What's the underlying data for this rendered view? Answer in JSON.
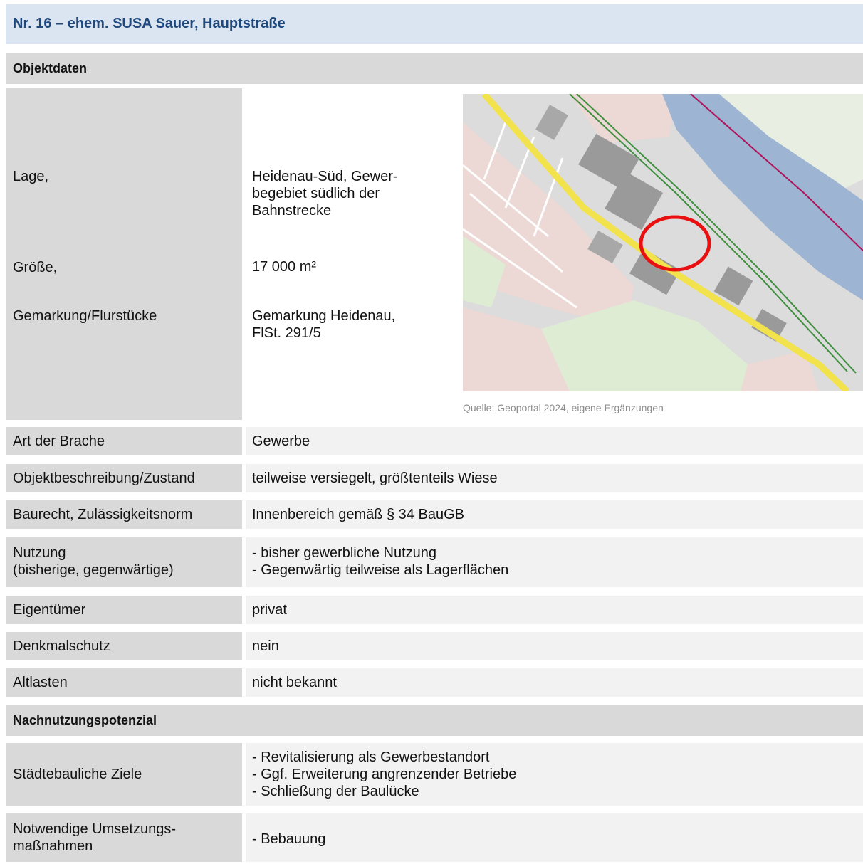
{
  "title": "Nr. 16 – ehem. SUSA Sauer, Hauptstraße",
  "sections": {
    "objektdaten": "Objektdaten",
    "nachnutzung": "Nachnutzungspotenzial"
  },
  "objekt": {
    "lage_label": "Lage,",
    "lage_value": [
      "Heidenau-Süd, Gewer-",
      "begebiet südlich der",
      "Bahnstrecke"
    ],
    "groesse_label": "Größe,",
    "groesse_value": "17 000 m²",
    "gemarkung_label": "Gemarkung/Flurstücke",
    "gemarkung_value": [
      "Gemarkung Heidenau,",
      "FlSt. 291/5"
    ]
  },
  "map": {
    "caption": "Quelle: Geoportal 2024, eigene Ergänzungen"
  },
  "rows": [
    {
      "label": [
        "Art der Brache"
      ],
      "value": [
        "Gewerbe"
      ]
    },
    {
      "label": [
        "Objektbeschreibung/Zustand"
      ],
      "value": [
        "teilweise versiegelt, größtenteils Wiese"
      ]
    },
    {
      "label": [
        "Baurecht, Zulässigkeitsnorm"
      ],
      "value": [
        "Innenbereich gemäß § 34 BauGB"
      ]
    },
    {
      "label": [
        "Nutzung",
        "(bisherige, gegenwärtige)"
      ],
      "value": [
        "-  bisher gewerbliche Nutzung",
        "-  Gegenwärtig teilweise als Lagerflächen"
      ]
    },
    {
      "label": [
        "Eigentümer"
      ],
      "value": [
        "privat"
      ]
    },
    {
      "label": [
        "Denkmalschutz"
      ],
      "value": [
        "nein"
      ]
    },
    {
      "label": [
        "Altlasten"
      ],
      "value": [
        "nicht bekannt"
      ]
    }
  ],
  "potenzial": [
    {
      "label": [
        "Städtebauliche Ziele"
      ],
      "value": [
        "-  Revitalisierung als Gewerbestandort",
        "-  Ggf. Erweiterung angrenzender Betriebe",
        "-  Schließung der Baulücke"
      ]
    },
    {
      "label": [
        "Notwendige Umsetzungs-",
        "maßnahmen"
      ],
      "value": [
        "-  Bebauung"
      ]
    }
  ]
}
